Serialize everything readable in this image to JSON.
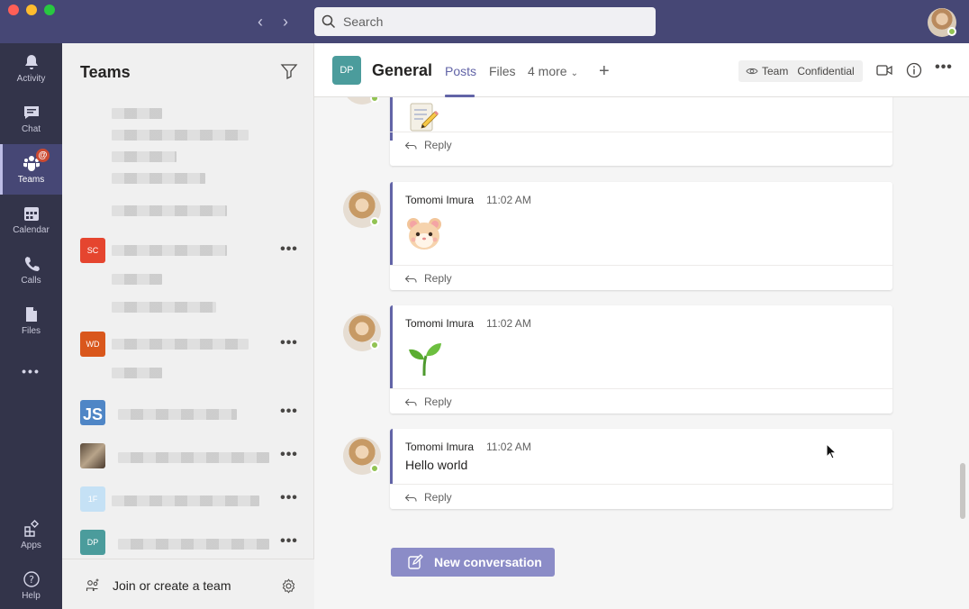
{
  "search": {
    "placeholder": "Search"
  },
  "rail": {
    "items": [
      {
        "label": "Activity",
        "icon": "bell-icon"
      },
      {
        "label": "Chat",
        "icon": "chat-icon"
      },
      {
        "label": "Teams",
        "icon": "teams-icon",
        "active": true,
        "badge": "@"
      },
      {
        "label": "Calendar",
        "icon": "calendar-icon"
      },
      {
        "label": "Calls",
        "icon": "phone-icon"
      },
      {
        "label": "Files",
        "icon": "file-icon"
      }
    ],
    "more": "•••",
    "apps_label": "Apps",
    "help_label": "Help"
  },
  "teams_panel": {
    "title": "Teams",
    "teams": [
      {
        "badge": "SC",
        "color": "#e5452f"
      },
      {
        "badge": "WD",
        "color": "#d9571c"
      },
      {
        "badge": "JS",
        "color": "#4f86c6"
      },
      {
        "badge": "",
        "color": "#8a7a6a"
      },
      {
        "badge": "1F",
        "color": "#c5e1f5"
      },
      {
        "badge": "DP",
        "color": "#4b9c9c"
      }
    ],
    "more_label": "•••",
    "join_label": "Join or create a team"
  },
  "channel": {
    "badge": "DP",
    "title": "General",
    "tabs": {
      "posts": "Posts",
      "files": "Files",
      "more": "4 more"
    },
    "add_tab": "+",
    "sensitivity": {
      "team": "Team",
      "label": "Confidential"
    },
    "more": "•••"
  },
  "messages": [
    {
      "author": "",
      "time": "",
      "text": "",
      "emoji": "memo-emoji",
      "reply": "Reply"
    },
    {
      "author": "Tomomi Imura",
      "time": "11:02 AM",
      "text": "",
      "emoji": "hamster-emoji",
      "reply": "Reply"
    },
    {
      "author": "Tomomi Imura",
      "time": "11:02 AM",
      "text": "",
      "emoji": "seedling-emoji",
      "reply": "Reply"
    },
    {
      "author": "Tomomi Imura",
      "time": "11:02 AM",
      "text": "Hello world",
      "emoji": "",
      "reply": "Reply"
    }
  ],
  "new_conversation": "New conversation",
  "colors": {
    "titlebar": "#464775",
    "rail": "#33344a",
    "accent": "#6264a7",
    "presence": "#92c353"
  }
}
